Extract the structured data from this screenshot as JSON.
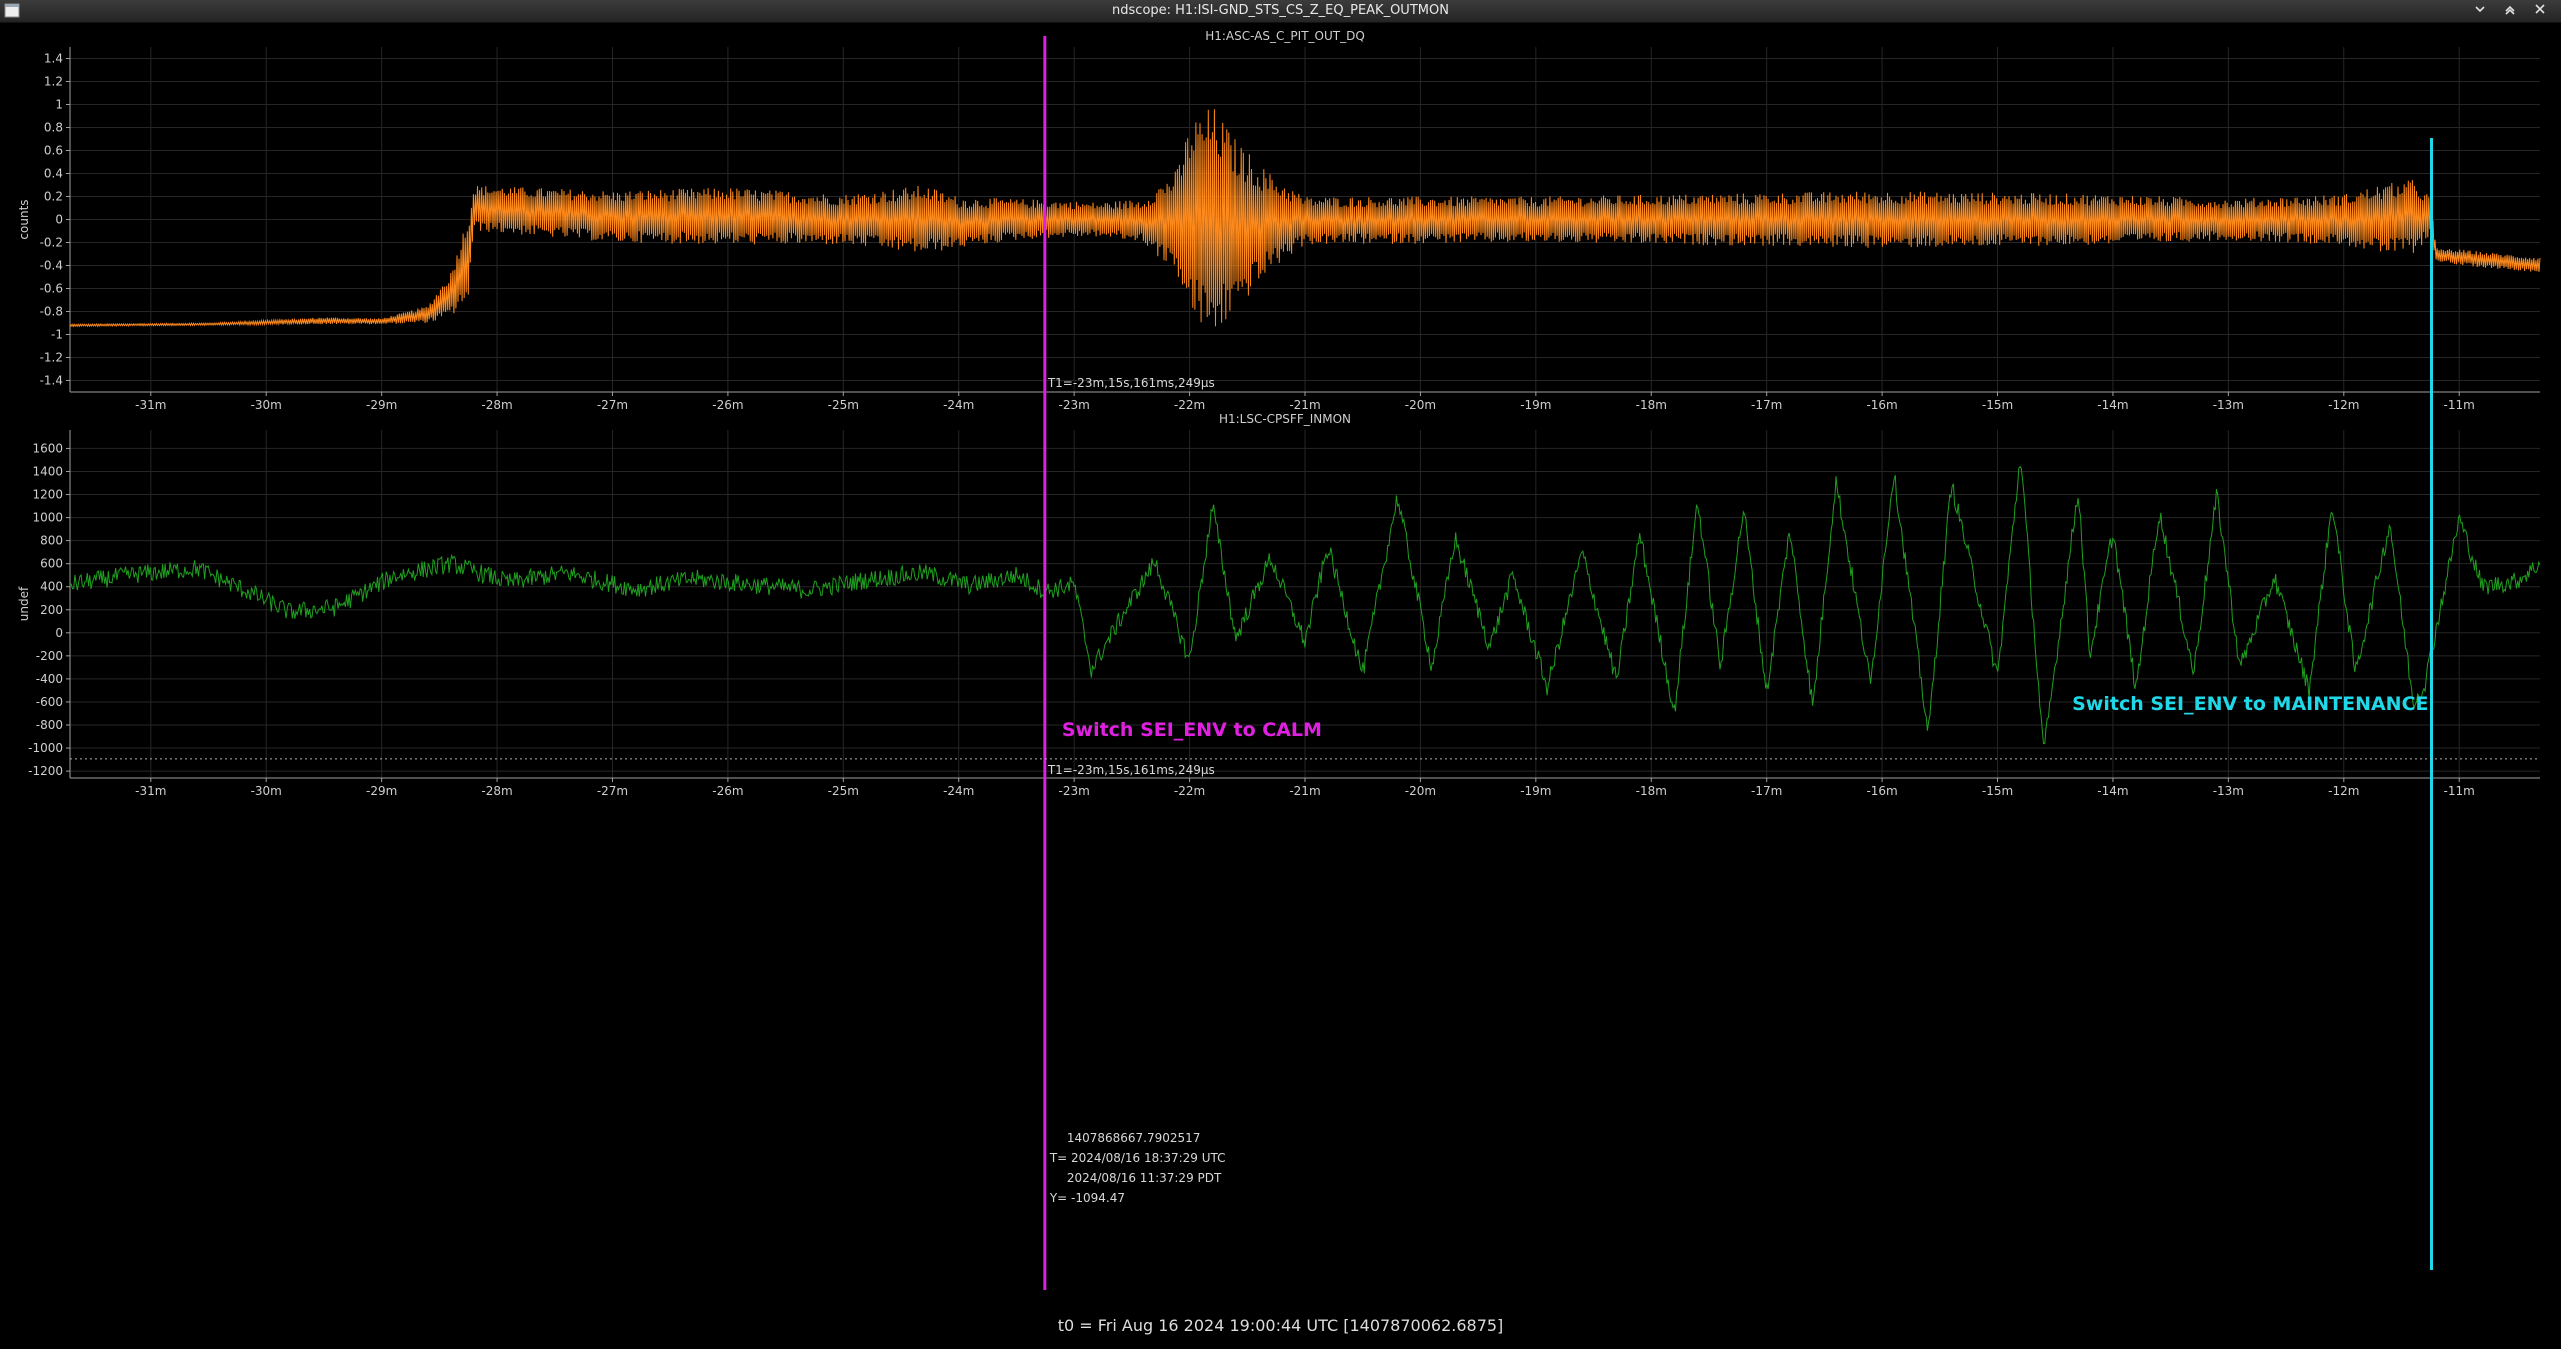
{
  "window": {
    "title": "ndscope: H1:ISI-GND_STS_CS_Z_EQ_PEAK_OUTMON",
    "min_icon": "chevron-down-icon",
    "max_icon": "restore-icon",
    "close_icon": "close-icon"
  },
  "footer": {
    "t0_label": "t0 = Fri Aug 16 2024 19:00:44 UTC [1407870062.6875]"
  },
  "cursors": {
    "t1_label": "T1=-23m,15s,161ms,249µs",
    "t1_minutes": -23.254,
    "t1_color": "#e020e0",
    "t2_minutes": -11.24,
    "t2_color": "#20d8e8",
    "y_cursor_value": -1094.47,
    "readout": {
      "gps": "1407868667.7902517",
      "utc": "T= 2024/08/16 18:37:29 UTC",
      "pdt": "2024/08/16 11:37:29 PDT",
      "y": "Y= -1094.47"
    }
  },
  "annotations": {
    "calm": {
      "text": "Switch SEI_ENV to CALM",
      "color": "#e020e0"
    },
    "maintenance": {
      "text": "Switch SEI_ENV to MAINTENANCE",
      "color": "#20d8e8"
    }
  },
  "chart_data": [
    {
      "type": "line",
      "title": "H1:ASC-AS_C_PIT_OUT_DQ",
      "xlabel": "",
      "ylabel": "counts",
      "xlim": [
        -31.7,
        -10.3
      ],
      "ylim": [
        -1.5,
        1.5
      ],
      "xticks": [
        -31,
        -30,
        -29,
        -28,
        -27,
        -26,
        -25,
        -24,
        -23,
        -22,
        -21,
        -20,
        -19,
        -18,
        -17,
        -16,
        -15,
        -14,
        -13,
        -12,
        -11
      ],
      "xtick_labels": [
        "-31m",
        "-30m",
        "-29m",
        "-28m",
        "-27m",
        "-26m",
        "-25m",
        "-24m",
        "-23m",
        "-22m",
        "-21m",
        "-20m",
        "-19m",
        "-18m",
        "-17m",
        "-16m",
        "-15m",
        "-14m",
        "-13m",
        "-12m",
        "-11m"
      ],
      "yticks": [
        -1.4,
        -1.2,
        -1,
        -0.8,
        -0.6,
        -0.4,
        -0.2,
        0,
        0.2,
        0.4,
        0.6,
        0.8,
        1,
        1.2,
        1.4
      ],
      "ytick_labels": [
        "-1.4",
        "-1.2",
        "-1",
        "-0.8",
        "-0.6",
        "-0.4",
        "-0.2",
        "0",
        "0.2",
        "0.4",
        "0.6",
        "0.8",
        "1",
        "1.2",
        "1.4"
      ],
      "grid": true,
      "color": "#ff8a1c",
      "envelope": {
        "x": [
          -31.7,
          -30.5,
          -29.5,
          -29.0,
          -28.6,
          -28.4,
          -28.25,
          -28.2,
          -27.0,
          -26.0,
          -25.0,
          -24.3,
          -24.0,
          -23.5,
          -23.2,
          -22.8,
          -22.4,
          -22.1,
          -22.0,
          -21.8,
          -21.6,
          -21.3,
          -21.0,
          -19.0,
          -16.0,
          -14.0,
          -13.0,
          -12.0,
          -11.7,
          -11.4,
          -11.25,
          -11.2,
          -11.0,
          -10.3
        ],
        "upper": [
          -0.91,
          -0.9,
          -0.85,
          -0.86,
          -0.75,
          -0.45,
          0.05,
          0.3,
          0.25,
          0.28,
          0.22,
          0.3,
          0.2,
          0.18,
          0.17,
          0.15,
          0.18,
          0.45,
          0.85,
          1.0,
          0.7,
          0.4,
          0.2,
          0.2,
          0.25,
          0.22,
          0.18,
          0.22,
          0.3,
          0.35,
          0.2,
          -0.25,
          -0.26,
          -0.33
        ],
        "lower": [
          -0.93,
          -0.92,
          -0.91,
          -0.91,
          -0.9,
          -0.85,
          -0.7,
          -0.1,
          -0.2,
          -0.22,
          -0.22,
          -0.3,
          -0.25,
          -0.18,
          -0.16,
          -0.15,
          -0.2,
          -0.5,
          -0.85,
          -1.05,
          -0.8,
          -0.45,
          -0.22,
          -0.2,
          -0.25,
          -0.22,
          -0.18,
          -0.22,
          -0.3,
          -0.3,
          -0.15,
          -0.36,
          -0.4,
          -0.46
        ]
      }
    },
    {
      "type": "line",
      "title": "H1:LSC-CPSFF_INMON",
      "xlabel": "",
      "ylabel": "undef",
      "xlim": [
        -31.7,
        -10.3
      ],
      "ylim": [
        -1260,
        1760
      ],
      "xticks": [
        -31,
        -30,
        -29,
        -28,
        -27,
        -26,
        -25,
        -24,
        -23,
        -22,
        -21,
        -20,
        -19,
        -18,
        -17,
        -16,
        -15,
        -14,
        -13,
        -12,
        -11
      ],
      "xtick_labels": [
        "-31m",
        "-30m",
        "-29m",
        "-28m",
        "-27m",
        "-26m",
        "-25m",
        "-24m",
        "-23m",
        "-22m",
        "-21m",
        "-20m",
        "-19m",
        "-18m",
        "-17m",
        "-16m",
        "-15m",
        "-14m",
        "-13m",
        "-12m",
        "-11m"
      ],
      "yticks": [
        -1200,
        -1000,
        -800,
        -600,
        -400,
        -200,
        0,
        200,
        400,
        600,
        800,
        1000,
        1200,
        1400,
        1600
      ],
      "ytick_labels": [
        "-1200",
        "-1000",
        "-800",
        "-600",
        "-400",
        "-200",
        "0",
        "200",
        "400",
        "600",
        "800",
        "1000",
        "1200",
        "1400",
        "1600"
      ],
      "grid": true,
      "color": "#1fa01f",
      "x": [
        -31.7,
        -31.2,
        -30.6,
        -30.1,
        -29.8,
        -29.4,
        -28.9,
        -28.4,
        -27.9,
        -27.4,
        -26.8,
        -26.3,
        -25.8,
        -25.3,
        -24.8,
        -24.3,
        -23.9,
        -23.5,
        -23.25,
        -23.0,
        -22.85,
        -22.6,
        -22.3,
        -22.0,
        -21.8,
        -21.6,
        -21.3,
        -21.0,
        -20.8,
        -20.5,
        -20.2,
        -19.9,
        -19.7,
        -19.4,
        -19.2,
        -18.9,
        -18.6,
        -18.3,
        -18.1,
        -17.8,
        -17.6,
        -17.4,
        -17.2,
        -17.0,
        -16.8,
        -16.6,
        -16.4,
        -16.1,
        -15.9,
        -15.6,
        -15.4,
        -15.0,
        -14.8,
        -14.6,
        -14.3,
        -14.2,
        -14.0,
        -13.8,
        -13.6,
        -13.3,
        -13.1,
        -12.9,
        -12.6,
        -12.3,
        -12.1,
        -11.9,
        -11.6,
        -11.4,
        -11.3,
        -11.0,
        -10.8,
        -10.5,
        -10.3
      ],
      "values": [
        420,
        500,
        560,
        330,
        180,
        220,
        490,
        600,
        440,
        520,
        380,
        470,
        420,
        370,
        460,
        520,
        410,
        500,
        360,
        420,
        -320,
        120,
        620,
        -250,
        1100,
        -50,
        650,
        -80,
        750,
        -350,
        1180,
        -300,
        820,
        -120,
        500,
        -480,
        700,
        -420,
        860,
        -700,
        1150,
        -300,
        1080,
        -520,
        900,
        -650,
        1320,
        -450,
        1400,
        -880,
        1300,
        -380,
        1550,
        -1050,
        1250,
        -200,
        880,
        -500,
        1050,
        -350,
        1200,
        -300,
        480,
        -500,
        1120,
        -350,
        950,
        -600,
        -450,
        1000,
        400,
        450,
        600
      ]
    }
  ]
}
